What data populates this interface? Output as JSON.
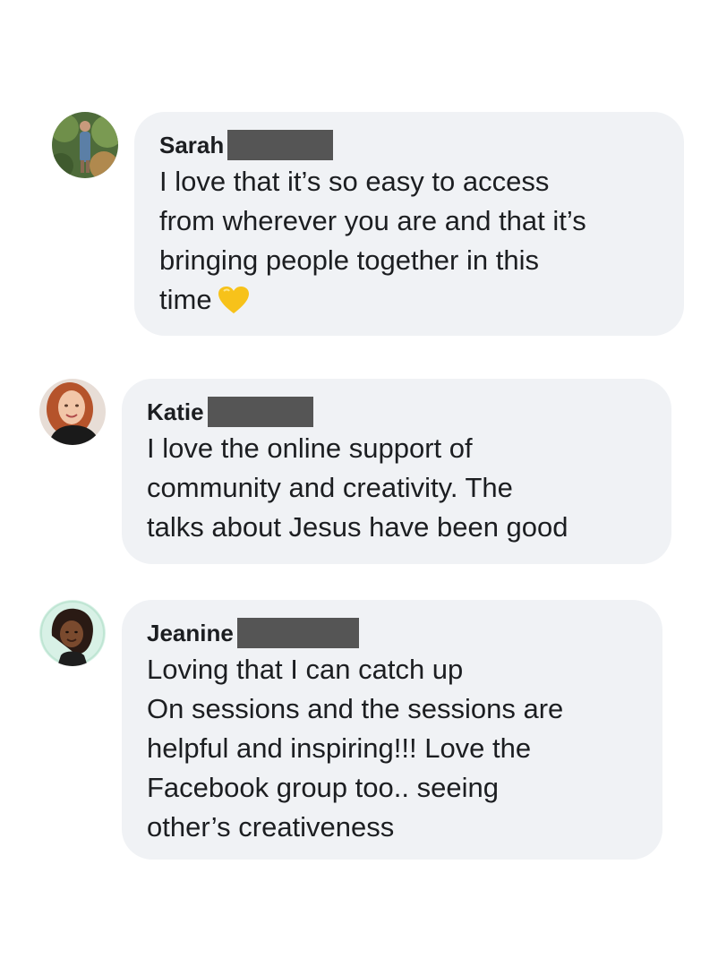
{
  "comments": [
    {
      "name": "Sarah",
      "text": "I love that it’s so easy to access\nfrom wherever you are and that it’s\nbringing people together in this\ntime",
      "emoji": "yellow-heart-icon"
    },
    {
      "name": "Katie",
      "text": "I love the online support of\ncommunity and creativity. The\ntalks about Jesus have been good"
    },
    {
      "name": "Jeanine",
      "text": "Loving that I can catch up\nOn sessions and the sessions are\nhelpful and inspiring!!! Love the\nFacebook group too.. seeing\nother’s creativeness"
    }
  ],
  "colors": {
    "bubble": "#f0f2f5",
    "redaction": "#555555",
    "text": "#1c1e21",
    "heart": "#f7c21a"
  }
}
